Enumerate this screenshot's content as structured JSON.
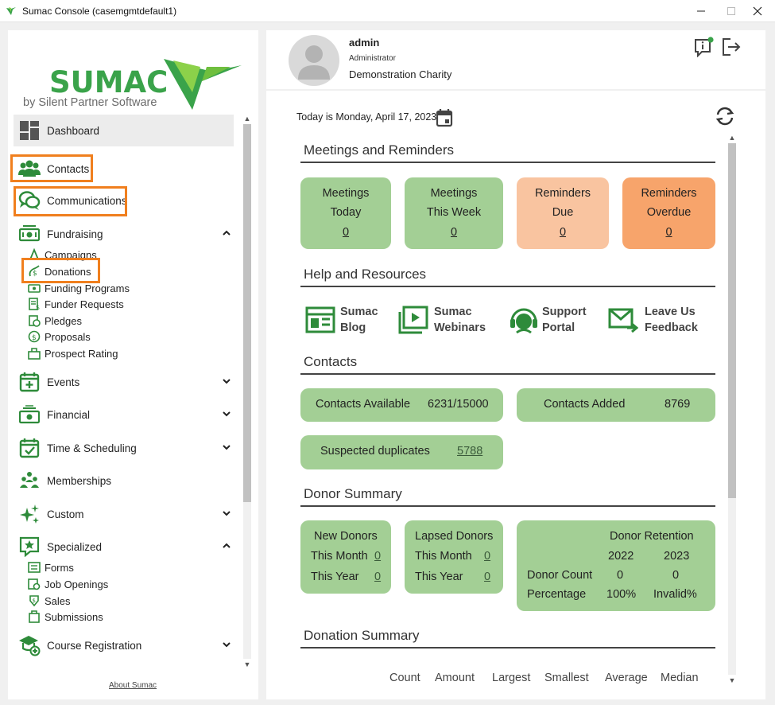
{
  "window": {
    "title": "Sumac Console (casemgmtdefault1)"
  },
  "logo": {
    "brand": "SUMAC",
    "tagline": "by Silent Partner Software"
  },
  "nav": {
    "dashboard": "Dashboard",
    "contacts": "Contacts",
    "communications": "Communications",
    "fundraising": "Fundraising",
    "fundraising_items": [
      "Campaigns",
      "Donations",
      "Funding Programs",
      "Funder Requests",
      "Pledges",
      "Proposals",
      "Prospect Rating"
    ],
    "events": "Events",
    "financial": "Financial",
    "time_scheduling": "Time & Scheduling",
    "memberships": "Memberships",
    "custom": "Custom",
    "specialized": "Specialized",
    "specialized_items": [
      "Forms",
      "Job Openings",
      "Sales",
      "Submissions"
    ],
    "course_registration": "Course Registration",
    "about": "About Sumac"
  },
  "user": {
    "name": "admin",
    "role": "Administrator",
    "org": "Demonstration Charity"
  },
  "today": "Today is Monday, April 17, 2023",
  "meetings": {
    "title": "Meetings and Reminders",
    "tiles": [
      {
        "l1": "Meetings",
        "l2": "Today",
        "value": "0"
      },
      {
        "l1": "Meetings",
        "l2": "This Week",
        "value": "0"
      },
      {
        "l1": "Reminders",
        "l2": "Due",
        "value": "0"
      },
      {
        "l1": "Reminders",
        "l2": "Overdue",
        "value": "0"
      }
    ]
  },
  "help": {
    "title": "Help and Resources",
    "items": [
      {
        "l1": "Sumac",
        "l2": "Blog"
      },
      {
        "l1": "Sumac",
        "l2": "Webinars"
      },
      {
        "l1": "Support",
        "l2": "Portal"
      },
      {
        "l1": "Leave Us",
        "l2": "Feedback"
      }
    ]
  },
  "contacts": {
    "title": "Contacts",
    "available_label": "Contacts Available",
    "available_value": "6231/15000",
    "added_label": "Contacts Added",
    "added_value": "8769",
    "dup_label": "Suspected duplicates",
    "dup_value": "5788"
  },
  "donor": {
    "title": "Donor Summary",
    "new": {
      "title": "New Donors",
      "month_label": "This Month",
      "month": "0",
      "year_label": "This Year",
      "year": "0"
    },
    "lapsed": {
      "title": "Lapsed Donors",
      "month_label": "This Month",
      "month": "0",
      "year_label": "This Year",
      "year": "0"
    },
    "retention": {
      "title": "Donor Retention",
      "y1": "2022",
      "y2": "2023",
      "count_label": "Donor Count",
      "count1": "0",
      "count2": "0",
      "pct_label": "Percentage",
      "pct1": "100%",
      "pct2": "Invalid%"
    }
  },
  "donation": {
    "title": "Donation Summary",
    "columns": [
      "Count",
      "Amount",
      "Largest",
      "Smallest",
      "Average",
      "Median"
    ]
  },
  "colors": {
    "green_tile": "#a3cf95",
    "peach_tile": "#f9c4a0",
    "orange_tile": "#f7a46b",
    "brand_green": "#2e9b3e",
    "highlight": "#f07f1e"
  },
  "icons": [
    "sumac-app-icon",
    "minimize-icon",
    "maximize-icon",
    "close-icon",
    "dashboard-icon",
    "contacts-icon",
    "communications-icon",
    "fundraising-icon",
    "events-icon",
    "financial-icon",
    "time-scheduling-icon",
    "memberships-icon",
    "custom-icon",
    "specialized-icon",
    "course-registration-icon",
    "notifications-icon",
    "logout-icon",
    "calendar-icon",
    "refresh-icon",
    "blog-icon",
    "webinars-icon",
    "support-icon",
    "feedback-icon"
  ]
}
